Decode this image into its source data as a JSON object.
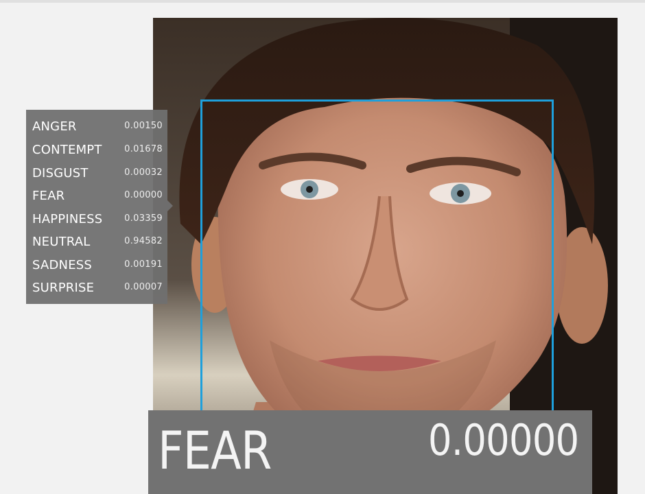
{
  "emotion_scores": [
    {
      "label": "ANGER",
      "value": "0.00150"
    },
    {
      "label": "CONTEMPT",
      "value": "0.01678"
    },
    {
      "label": "DISGUST",
      "value": "0.00032"
    },
    {
      "label": "FEAR",
      "value": "0.00000"
    },
    {
      "label": "HAPPINESS",
      "value": "0.03359"
    },
    {
      "label": "NEUTRAL",
      "value": "0.94582"
    },
    {
      "label": "SADNESS",
      "value": "0.00191"
    },
    {
      "label": "SURPRISE",
      "value": "0.00007"
    }
  ],
  "result": {
    "label": "FEAR",
    "value": "0.00000"
  },
  "colors": {
    "face_box": "#1ea0dc",
    "panel": "#707070",
    "text": "#ffffff"
  }
}
